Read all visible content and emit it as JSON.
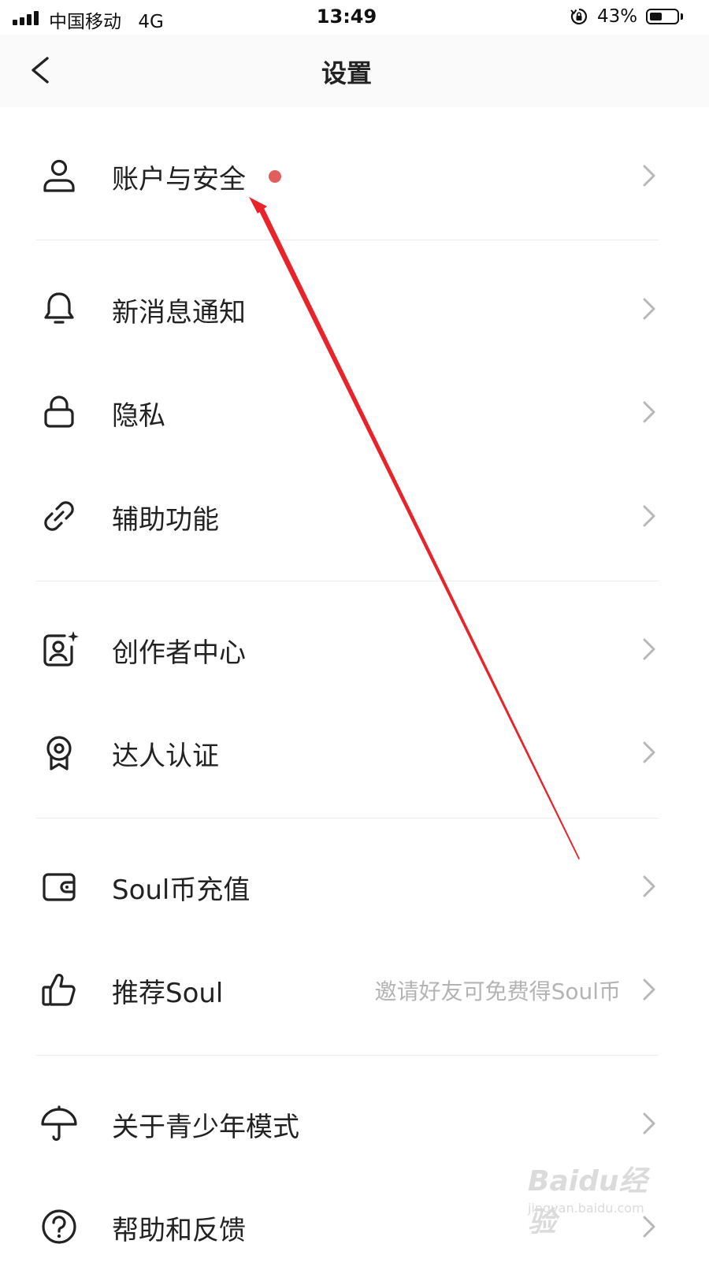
{
  "status_bar": {
    "carrier": "中国移动",
    "network": "4G",
    "time": "13:49",
    "battery_percent": "43%",
    "battery_level": 0.43,
    "icons": [
      "signal-icon",
      "rotation-lock-icon",
      "battery-icon"
    ]
  },
  "nav": {
    "title": "设置",
    "back_icon": "chevron-left-icon"
  },
  "settings": {
    "items": [
      {
        "label": "账户与安全",
        "icon": "user-icon",
        "badge": true
      },
      {
        "label": "新消息通知",
        "icon": "bell-icon"
      },
      {
        "label": "隐私",
        "icon": "lock-icon"
      },
      {
        "label": "辅助功能",
        "icon": "link-icon"
      },
      {
        "label": "创作者中心",
        "icon": "creator-icon"
      },
      {
        "label": "达人认证",
        "icon": "award-badge-icon"
      },
      {
        "label": "Soul币充值",
        "icon": "wallet-icon"
      },
      {
        "label": "推荐Soul",
        "icon": "thumbs-up-icon",
        "hint": "邀请好友可免费得Soul币"
      },
      {
        "label": "关于青少年模式",
        "icon": "umbrella-icon"
      },
      {
        "label": "帮助和反馈",
        "icon": "help-icon"
      }
    ]
  },
  "annotation": {
    "arrow_color": "#e8232a",
    "badge_color": "#e35d5f"
  },
  "watermark": {
    "brand": "Baidu经验",
    "url": "jingyan.baidu.com"
  }
}
